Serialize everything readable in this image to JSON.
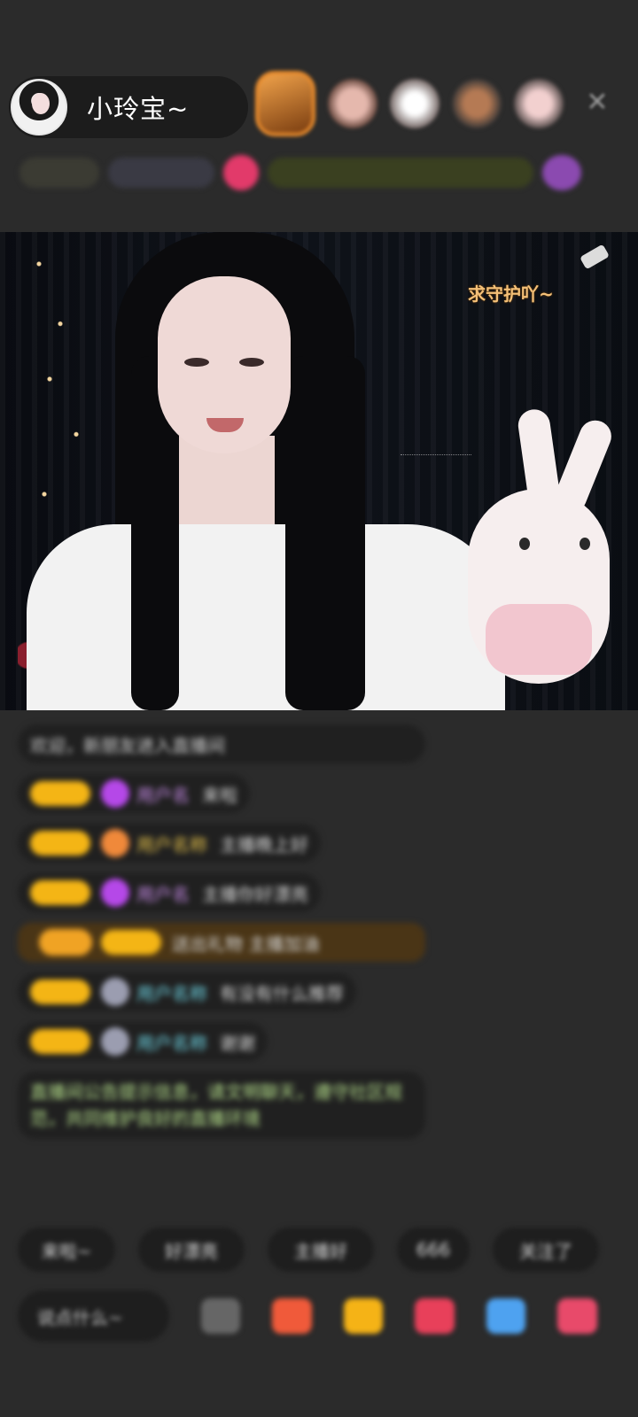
{
  "header": {
    "host_name": "小玲宝~",
    "close_icon": "close-icon",
    "viewers": [
      "viewer-avatar-1",
      "viewer-avatar-2",
      "viewer-avatar-3",
      "viewer-avatar-4",
      "viewer-avatar-5"
    ]
  },
  "video": {
    "overlay_text": "求守护吖~"
  },
  "chat": {
    "messages": [
      {
        "type": "notice",
        "text": "欢迎，新朋友进入直播间"
      },
      {
        "type": "user",
        "level_color": "#f4b515",
        "gem": "purple",
        "name": "用户名",
        "text": "来啦"
      },
      {
        "type": "user",
        "level_color": "#f4b515",
        "gem": "orange",
        "name": "用户名称",
        "text": "主播晚上好"
      },
      {
        "type": "user",
        "level_color": "#f4b515",
        "gem": "purple",
        "name": "用户名",
        "text": "主播你好漂亮"
      },
      {
        "type": "gift",
        "text": "送出礼物 主播加油"
      },
      {
        "type": "user",
        "level_color": "#f4b515",
        "gem": "grey",
        "name": "用户名称",
        "text": "有没有什么推荐"
      },
      {
        "type": "user",
        "level_color": "#f4b515",
        "gem": "grey",
        "name": "用户名称",
        "text": "谢谢"
      },
      {
        "type": "system",
        "text": "直播间公告提示信息，请文明聊天，遵守社区规范，共同维护良好的直播环境"
      }
    ]
  },
  "quick_replies": [
    "来啦~",
    "好漂亮",
    "主播好",
    "666",
    "关注了"
  ],
  "bottom_bar": {
    "input_placeholder": "说点什么~",
    "icons": [
      "more-icon",
      "gift-box-icon",
      "red-packet-icon",
      "heart-icon",
      "game-icon",
      "shop-icon"
    ]
  },
  "colors": {
    "background": "#2b2b2b",
    "accent_gold": "#f4b515",
    "overlay_text": "#f4c078"
  }
}
